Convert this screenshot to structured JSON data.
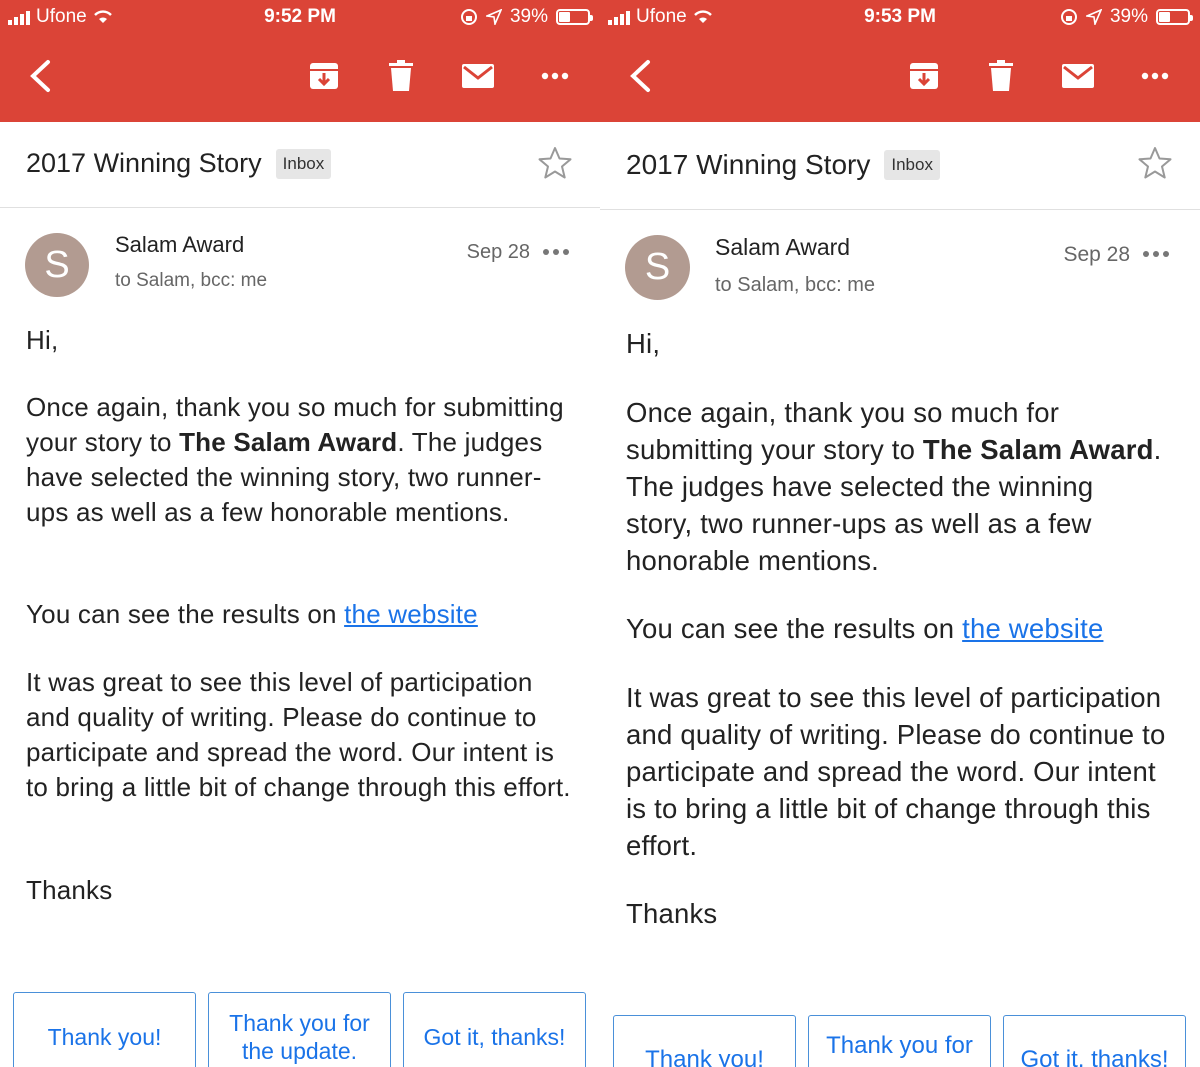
{
  "left": {
    "status": {
      "carrier": "Ufone",
      "time": "9:52 PM",
      "battery": "39%"
    },
    "subject": "2017 Winning Story",
    "label": "Inbox",
    "sender": {
      "initial": "S",
      "name": "Salam Award",
      "recipients": "to Salam, bcc: me",
      "date": "Sep 28"
    },
    "body": {
      "greeting": "Hi,",
      "p1_a": "Once again, thank you so much for submitting your story to ",
      "p1_bold": "The Salam Award",
      "p1_b": ". The judges have selected the winning story, two runner-ups as well as a few honorable mentions.",
      "p2_a": "You can see the results on ",
      "p2_link": "the website",
      "p3": "It was great to see this level of participation and quality of writing. Please do continue to participate and spread the word. Our intent is to bring a little bit of change through this effort.",
      "closing": "Thanks"
    },
    "smart_replies": [
      "Thank you!",
      "Thank you for the update.",
      "Got it, thanks!"
    ]
  },
  "right": {
    "status": {
      "carrier": "Ufone",
      "time": "9:53 PM",
      "battery": "39%"
    },
    "subject": "2017 Winning Story",
    "label": "Inbox",
    "sender": {
      "initial": "S",
      "name": "Salam Award",
      "recipients": "to Salam, bcc: me",
      "date": "Sep 28"
    },
    "body": {
      "greeting": "Hi,",
      "p1_a": "Once again, thank you so much for submitting your story to ",
      "p1_bold": "The Salam Award",
      "p1_b": ". The judges have selected the winning story, two runner-ups as well as a few honorable mentions.",
      "p2_a": "You can see the results on ",
      "p2_link": "the website",
      "p3": "It was great to see this level of participation and quality of writing. Please do continue to participate and spread the word. Our intent is to bring a little bit of change through this effort.",
      "closing": "Thanks"
    },
    "smart_replies": [
      "Thank you!",
      "Thank you for",
      "Got it, thanks!"
    ]
  },
  "colors": {
    "app_bar": "#db4437",
    "link": "#1a73e8",
    "avatar": "#b29b91"
  },
  "icons": [
    "back-arrow-icon",
    "archive-icon",
    "trash-icon",
    "mail-icon",
    "more-icon",
    "star-icon",
    "wifi-icon",
    "location-icon",
    "rotation-lock-icon",
    "battery-icon"
  ]
}
